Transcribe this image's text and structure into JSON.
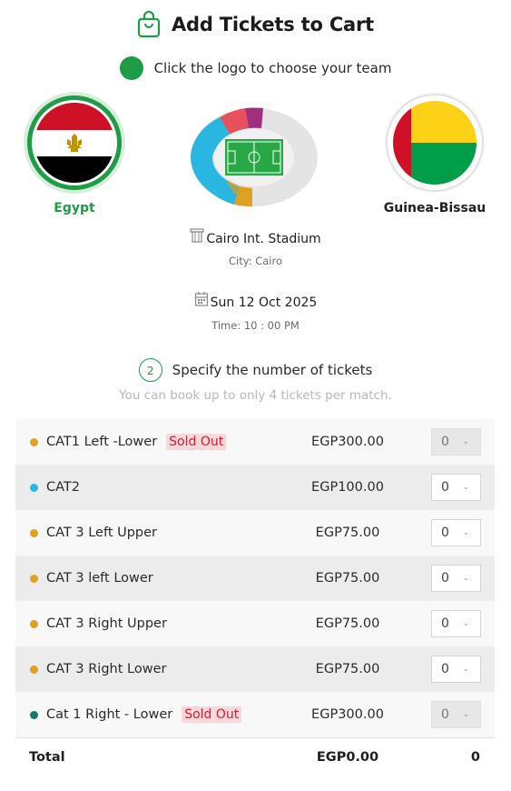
{
  "header": {
    "title": "Add Tickets to Cart",
    "icon": "shopping-bag-icon"
  },
  "step1": {
    "text": "Click the logo to choose your team"
  },
  "teams": {
    "home": {
      "name": "Egypt",
      "selected": true,
      "flag_colors": [
        "#ce1126",
        "#ffffff",
        "#000000"
      ]
    },
    "away": {
      "name": "Guinea-Bissau",
      "selected": false,
      "flag_colors": [
        "#ce1126",
        "#fcd116",
        "#009e49"
      ]
    }
  },
  "venue": {
    "stadium": "Cairo Int. Stadium",
    "city": "City: Cairo",
    "icon": "stadium-icon"
  },
  "match": {
    "date": "Sun 12 Oct 2025",
    "time": "Time: 10 : 00 PM",
    "icon": "calendar-icon"
  },
  "step2": {
    "number": "2",
    "text": "Specify the number of tickets",
    "note": "You can book up to only 4 tickets per match."
  },
  "tickets": [
    {
      "name": "CAT1 Left -Lower",
      "sold_out": true,
      "sold_out_label": "Sold Out",
      "price": "EGP300.00",
      "qty": "0",
      "color": "#e0a020"
    },
    {
      "name": "CAT2",
      "sold_out": false,
      "sold_out_label": "",
      "price": "EGP100.00",
      "qty": "0",
      "color": "#29b6e0"
    },
    {
      "name": "CAT 3 Left Upper",
      "sold_out": false,
      "sold_out_label": "",
      "price": "EGP75.00",
      "qty": "0",
      "color": "#e0a020"
    },
    {
      "name": "CAT 3 left Lower",
      "sold_out": false,
      "sold_out_label": "",
      "price": "EGP75.00",
      "qty": "0",
      "color": "#e0a020"
    },
    {
      "name": "CAT 3 Right Upper",
      "sold_out": false,
      "sold_out_label": "",
      "price": "EGP75.00",
      "qty": "0",
      "color": "#e0a020"
    },
    {
      "name": "CAT 3 Right Lower",
      "sold_out": false,
      "sold_out_label": "",
      "price": "EGP75.00",
      "qty": "0",
      "color": "#e0a020"
    },
    {
      "name": "Cat 1 Right - Lower",
      "sold_out": true,
      "sold_out_label": "Sold Out",
      "price": "EGP300.00",
      "qty": "0",
      "color": "#0f7a6c"
    }
  ],
  "total": {
    "label": "Total",
    "amount": "EGP0.00",
    "count": "0"
  },
  "colors": {
    "accent": "#1e9c46",
    "sold_out_bg": "#fcd7da",
    "sold_out_text": "#cc2233"
  }
}
